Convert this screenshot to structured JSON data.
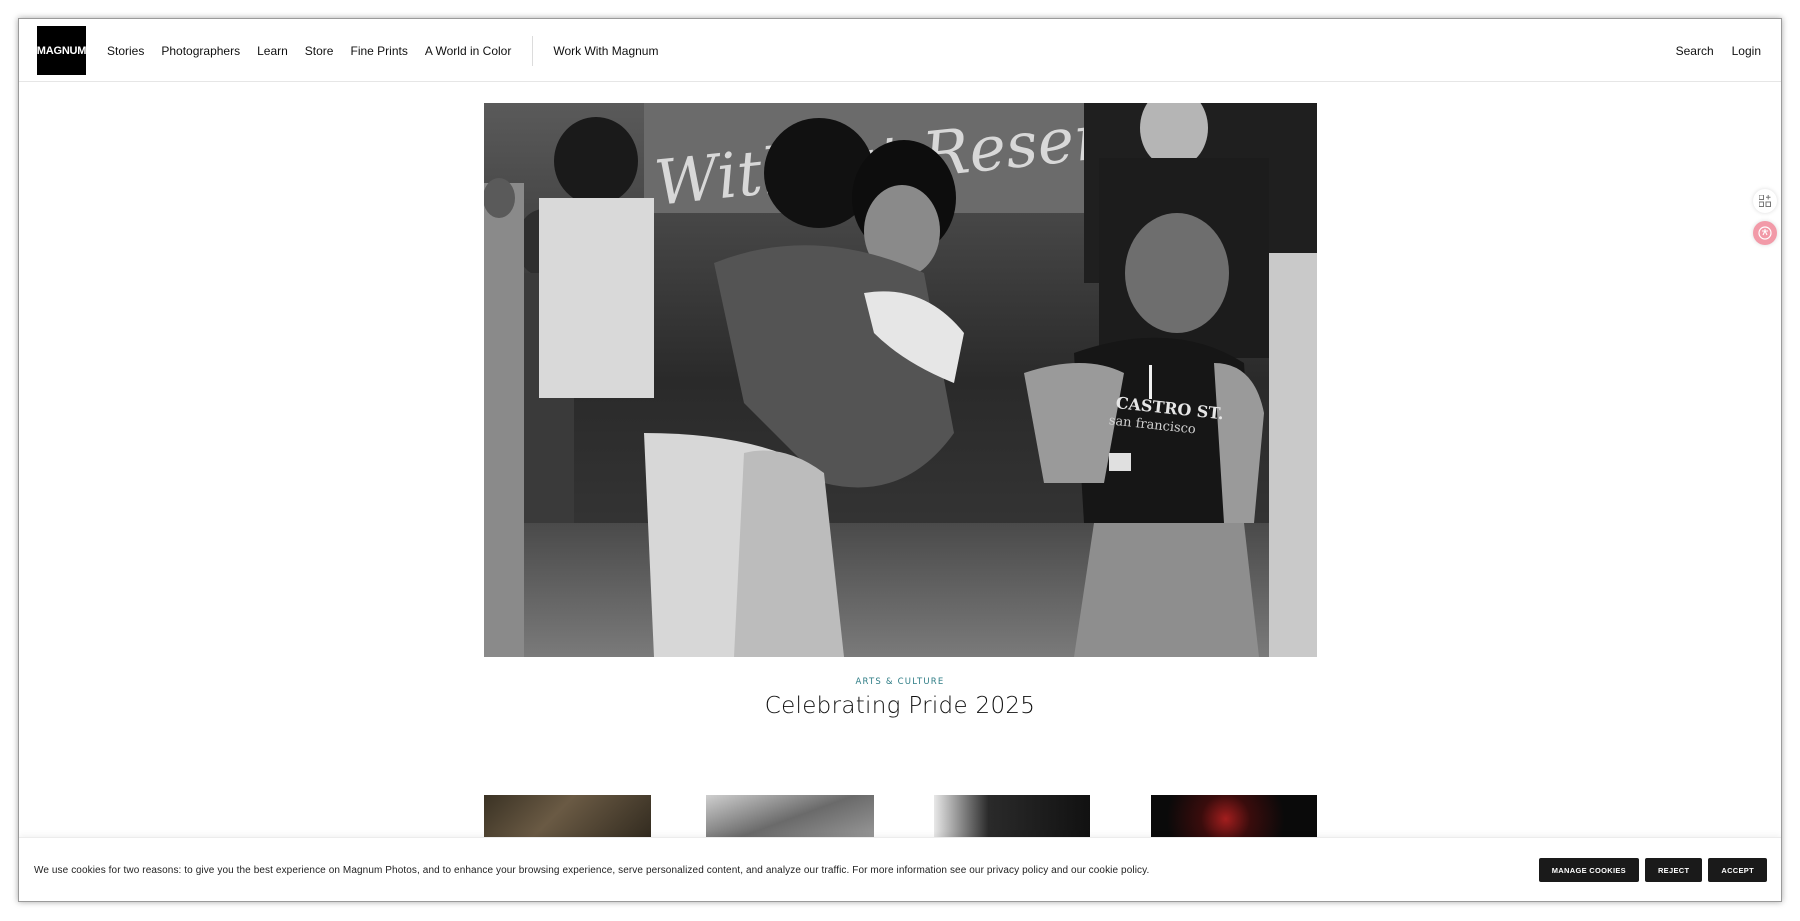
{
  "header": {
    "logo_text": "MAGNUM",
    "nav": [
      {
        "label": "Stories"
      },
      {
        "label": "Photographers"
      },
      {
        "label": "Learn"
      },
      {
        "label": "Store"
      },
      {
        "label": "Fine Prints"
      },
      {
        "label": "A World in Color"
      }
    ],
    "work_with": "Work With Magnum",
    "search": "Search",
    "login": "Login"
  },
  "hero": {
    "category": "ARTS & CULTURE",
    "title": "Celebrating Pride 2025",
    "photo_sign_text": "Without Reservation",
    "shirt_text_1": "CASTRO ST.",
    "shirt_text_2": "san francisco"
  },
  "cookie": {
    "text": "We use cookies for two reasons: to give you the best experience on Magnum Photos, and to enhance your browsing experience, serve personalized content, and analyze our traffic. For more information see our privacy policy and our cookie policy.",
    "manage": "MANAGE COOKIES",
    "reject": "REJECT",
    "accept": "ACCEPT"
  },
  "colors": {
    "accent": "#2f7d86",
    "button_bg": "#1a1a1a"
  }
}
